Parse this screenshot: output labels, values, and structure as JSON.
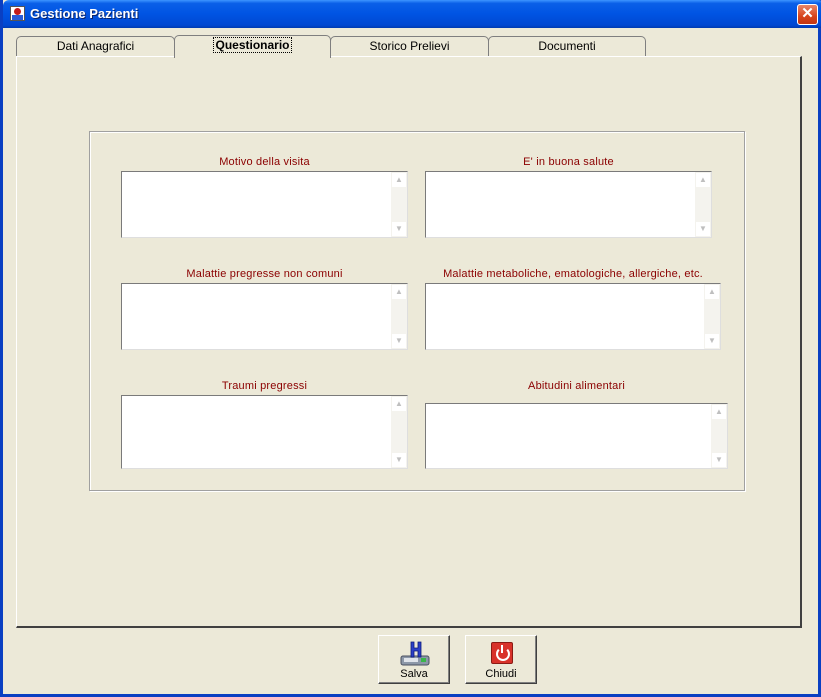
{
  "window": {
    "title": "Gestione Pazienti",
    "close_glyph": "✕"
  },
  "tabs": [
    {
      "label": "Dati Anagrafici"
    },
    {
      "label": "Questionario"
    },
    {
      "label": "Storico Prelievi"
    },
    {
      "label": "Documenti"
    }
  ],
  "questionnaire": {
    "fields": [
      {
        "label": "Motivo della visita",
        "value": ""
      },
      {
        "label": "E' in buona salute",
        "value": ""
      },
      {
        "label": "Malattie pregresse non comuni",
        "value": ""
      },
      {
        "label": "Malattie metaboliche, ematologiche, allergiche, etc.",
        "value": ""
      },
      {
        "label": "Traumi pregressi",
        "value": ""
      },
      {
        "label": "Abitudini alimentari",
        "value": ""
      }
    ]
  },
  "buttons": {
    "save_label": "Salva",
    "close_label": "Chiudi"
  },
  "icons": {
    "save": "floppy-save-icon",
    "close": "power-close-icon"
  }
}
